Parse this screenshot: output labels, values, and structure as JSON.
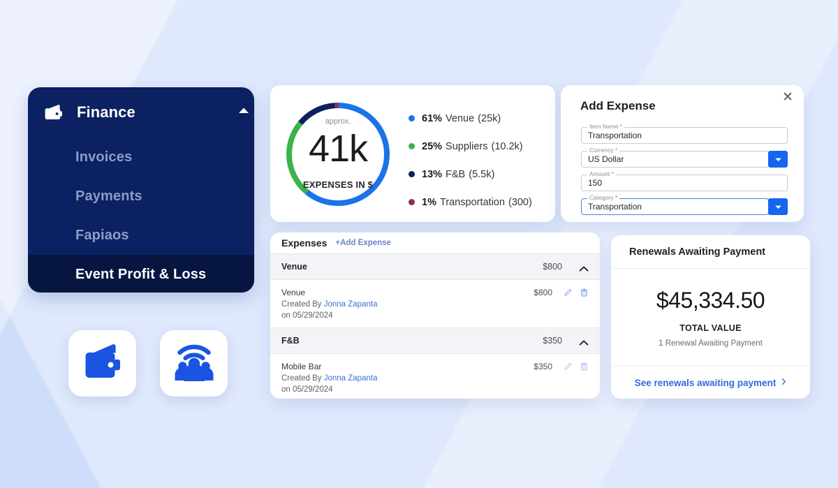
{
  "theme": {
    "page_background": "#dfe8fc",
    "sidebar_background": "#0b2161",
    "sidebar_active_background": "#071640",
    "accent_blue": "#1565f0",
    "link_blue": "#2f6ae0"
  },
  "sidebar": {
    "title": "Finance",
    "icon": "wallet-icon",
    "collapse_icon": "chevron-up-icon",
    "items": [
      {
        "label": "Invoices",
        "active": false
      },
      {
        "label": "Payments",
        "active": false
      },
      {
        "label": "Fapiaos",
        "active": false
      },
      {
        "label": "Event Profit & Loss",
        "active": true
      }
    ]
  },
  "tiles": [
    {
      "name": "wallet-icon",
      "color": "#1b54e0"
    },
    {
      "name": "group-wifi-icon",
      "color": "#1b54e0"
    }
  ],
  "chart_data": {
    "type": "pie",
    "title": "EXPENSES IN $",
    "center_label": "41k",
    "center_prefix": "approx.",
    "total": 41000,
    "categories": [
      "Venue",
      "Suppliers",
      "F&B",
      "Transportation"
    ],
    "values": [
      25000,
      10200,
      5500,
      300
    ],
    "percentages": [
      61,
      25,
      13,
      1
    ],
    "value_labels": [
      "25k",
      "10.2k",
      "5.5k",
      "300"
    ],
    "colors": [
      "#1a73e8",
      "#3cb34a",
      "#0d1f5e",
      "#8e2f45"
    ],
    "legend": [
      {
        "pct": "61%",
        "label": "Venue",
        "value": "(25k)",
        "color": "#1a73e8"
      },
      {
        "pct": "25%",
        "label": "Suppliers",
        "value": "(10.2k)",
        "color": "#3cb34a"
      },
      {
        "pct": "13%",
        "label": "F&B",
        "value": "(5.5k)",
        "color": "#0d1f5e"
      },
      {
        "pct": "1%",
        "label": "Transportation",
        "value": "(300)",
        "color": "#8e2f45"
      }
    ],
    "legend_position": "right",
    "donut": true
  },
  "add_expense": {
    "title": "Add Expense",
    "close_icon": "close-icon",
    "fields": [
      {
        "label": "Item Name *",
        "value": "Transportation",
        "type": "text",
        "focused": false
      },
      {
        "label": "Currency *",
        "value": "US Dollar",
        "type": "select",
        "focused": false
      },
      {
        "label": "Amount *",
        "value": "150",
        "type": "text",
        "focused": false
      },
      {
        "label": "Category *",
        "value": "Transportation",
        "type": "select",
        "focused": true
      }
    ]
  },
  "expenses": {
    "title": "Expenses",
    "add_link": "+Add Expense",
    "groups": [
      {
        "name": "Venue",
        "amount": "$800",
        "expanded": true,
        "rows": [
          {
            "name": "Venue",
            "amount": "$800",
            "created_by_prefix": "Created By",
            "created_by": "Jonna Zapanta",
            "date": "on 05/29/2024",
            "edit_icon": "pencil-icon",
            "delete_icon": "trash-icon"
          }
        ]
      },
      {
        "name": "F&B",
        "amount": "$350",
        "expanded": true,
        "rows": [
          {
            "name": "Mobile Bar",
            "amount": "$350",
            "created_by_prefix": "Created By",
            "created_by": "Jonna Zapanta",
            "date": "on 05/29/2024",
            "edit_icon": "pencil-icon",
            "delete_icon": "trash-icon"
          }
        ]
      }
    ]
  },
  "renewals": {
    "title": "Renewals Awaiting Payment",
    "amount": "$45,334.50",
    "total_label": "TOTAL VALUE",
    "note": "1 Renewal Awaiting Payment",
    "link": "See renewals awaiting payment",
    "link_icon": "chevron-right-icon"
  }
}
